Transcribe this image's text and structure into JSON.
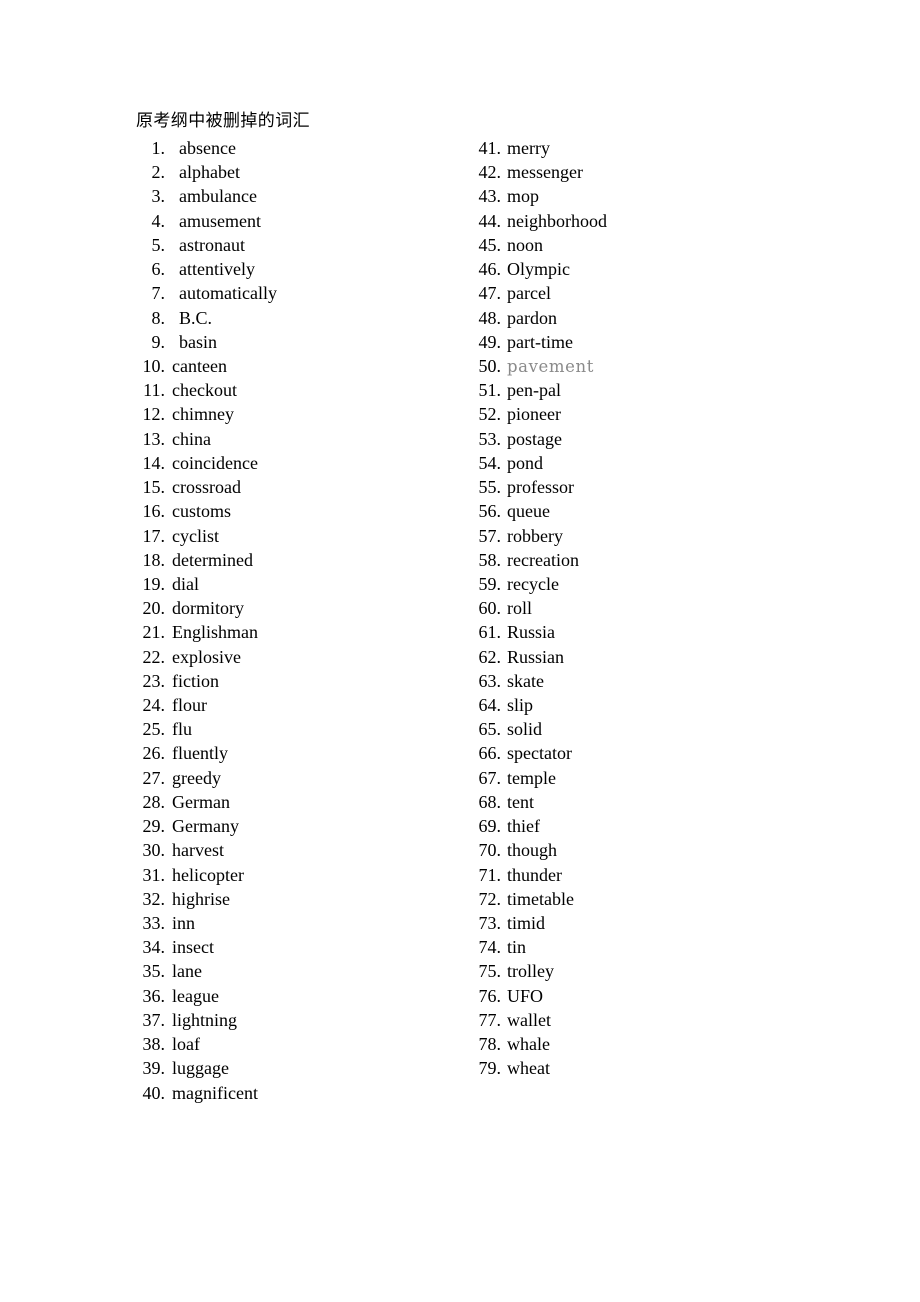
{
  "document": {
    "title": "原考纲中被删掉的词汇",
    "page_background": "#ffffff",
    "text_color": "#000000",
    "muted_color": "#8a8a8a"
  },
  "vocabulary": {
    "left_column": [
      {
        "num": "1.",
        "word": "absence"
      },
      {
        "num": "2.",
        "word": "alphabet"
      },
      {
        "num": "3.",
        "word": "ambulance"
      },
      {
        "num": "4.",
        "word": "amusement"
      },
      {
        "num": "5.",
        "word": "astronaut"
      },
      {
        "num": "6.",
        "word": "attentively"
      },
      {
        "num": "7.",
        "word": "automatically"
      },
      {
        "num": "8.",
        "word": "B.C."
      },
      {
        "num": "9.",
        "word": "basin"
      },
      {
        "num": "10.",
        "word": "canteen"
      },
      {
        "num": "11.",
        "word": "checkout"
      },
      {
        "num": "12.",
        "word": "chimney"
      },
      {
        "num": "13.",
        "word": "china"
      },
      {
        "num": "14.",
        "word": "coincidence"
      },
      {
        "num": "15.",
        "word": "crossroad"
      },
      {
        "num": "16.",
        "word": "customs"
      },
      {
        "num": "17.",
        "word": "cyclist"
      },
      {
        "num": "18.",
        "word": "determined"
      },
      {
        "num": "19.",
        "word": "dial"
      },
      {
        "num": "20.",
        "word": "dormitory"
      },
      {
        "num": "21.",
        "word": "Englishman"
      },
      {
        "num": "22.",
        "word": "explosive"
      },
      {
        "num": "23.",
        "word": "fiction"
      },
      {
        "num": "24.",
        "word": "flour"
      },
      {
        "num": "25.",
        "word": "flu"
      },
      {
        "num": "26.",
        "word": "fluently"
      },
      {
        "num": "27.",
        "word": "greedy"
      },
      {
        "num": "28.",
        "word": "German"
      },
      {
        "num": "29.",
        "word": "Germany"
      },
      {
        "num": "30.",
        "word": "harvest"
      },
      {
        "num": "31.",
        "word": "helicopter"
      },
      {
        "num": "32.",
        "word": "highrise"
      },
      {
        "num": "33.",
        "word": "inn"
      },
      {
        "num": "34.",
        "word": "insect"
      },
      {
        "num": "35.",
        "word": "lane"
      },
      {
        "num": "36.",
        "word": "league"
      },
      {
        "num": "37.",
        "word": "lightning"
      },
      {
        "num": "38.",
        "word": "loaf"
      },
      {
        "num": "39.",
        "word": "luggage"
      },
      {
        "num": "40.",
        "word": "magnificent"
      }
    ],
    "right_column": [
      {
        "num": "41.",
        "word": "merry"
      },
      {
        "num": "42.",
        "word": "messenger"
      },
      {
        "num": "43.",
        "word": "mop"
      },
      {
        "num": "44.",
        "word": "neighborhood"
      },
      {
        "num": "45.",
        "word": "noon"
      },
      {
        "num": "46.",
        "word": "Olympic"
      },
      {
        "num": "47.",
        "word": "parcel"
      },
      {
        "num": "48.",
        "word": "pardon"
      },
      {
        "num": "49.",
        "word": "part-time"
      },
      {
        "num": "50.",
        "word": "pavement",
        "style": "alt-font"
      },
      {
        "num": "51.",
        "word": "pen-pal"
      },
      {
        "num": "52.",
        "word": "pioneer"
      },
      {
        "num": "53.",
        "word": "postage"
      },
      {
        "num": "54.",
        "word": "pond"
      },
      {
        "num": "55.",
        "word": "professor"
      },
      {
        "num": "56.",
        "word": "queue"
      },
      {
        "num": "57.",
        "word": "robbery"
      },
      {
        "num": "58.",
        "word": "recreation"
      },
      {
        "num": "59.",
        "word": "recycle"
      },
      {
        "num": "60.",
        "word": "roll"
      },
      {
        "num": "61.",
        "word": "Russia"
      },
      {
        "num": "62.",
        "word": "Russian"
      },
      {
        "num": "63.",
        "word": "skate"
      },
      {
        "num": "64.",
        "word": "slip"
      },
      {
        "num": "65.",
        "word": "solid"
      },
      {
        "num": "66.",
        "word": "spectator"
      },
      {
        "num": "67.",
        "word": "temple"
      },
      {
        "num": "68.",
        "word": "tent"
      },
      {
        "num": "69.",
        "word": "thief"
      },
      {
        "num": "70.",
        "word": "though"
      },
      {
        "num": "71.",
        "word": "thunder"
      },
      {
        "num": "72.",
        "word": "timetable"
      },
      {
        "num": "73.",
        "word": "timid"
      },
      {
        "num": "74.",
        "word": "tin"
      },
      {
        "num": "75.",
        "word": "trolley"
      },
      {
        "num": "76.",
        "word": "UFO"
      },
      {
        "num": "77.",
        "word": "wallet"
      },
      {
        "num": "78.",
        "word": "whale"
      },
      {
        "num": "79.",
        "word": "wheat"
      }
    ]
  }
}
